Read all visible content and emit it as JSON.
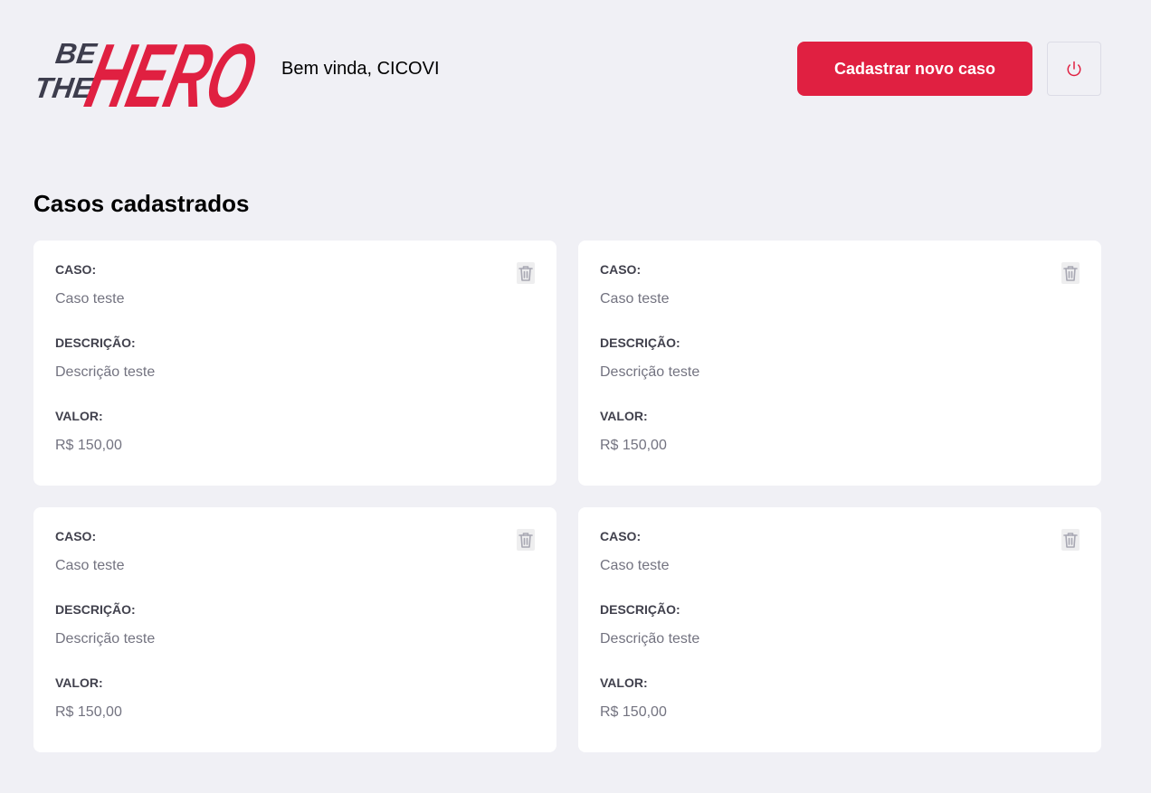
{
  "brand": {
    "logo_text_small_1": "BE",
    "logo_text_small_2": "THE",
    "logo_text_big": "HERO",
    "accent_color": "#e02041"
  },
  "header": {
    "welcome": "Bem vinda, CICOVI",
    "new_case_label": "Cadastrar novo caso",
    "logout_icon": "power-icon"
  },
  "main": {
    "title": "Casos cadastrados",
    "cases": [
      {
        "case_label": "CASO:",
        "case_value": "Caso teste",
        "desc_label": "DESCRIÇÃO:",
        "desc_value": "Descrição teste",
        "value_label": "VALOR:",
        "value_value": "R$ 150,00",
        "delete_icon": "trash-icon"
      },
      {
        "case_label": "CASO:",
        "case_value": "Caso teste",
        "desc_label": "DESCRIÇÃO:",
        "desc_value": "Descrição teste",
        "value_label": "VALOR:",
        "value_value": "R$ 150,00",
        "delete_icon": "trash-icon"
      },
      {
        "case_label": "CASO:",
        "case_value": "Caso teste",
        "desc_label": "DESCRIÇÃO:",
        "desc_value": "Descrição teste",
        "value_label": "VALOR:",
        "value_value": "R$ 150,00",
        "delete_icon": "trash-icon"
      },
      {
        "case_label": "CASO:",
        "case_value": "Caso teste",
        "desc_label": "DESCRIÇÃO:",
        "desc_value": "Descrição teste",
        "value_label": "VALOR:",
        "value_value": "R$ 150,00",
        "delete_icon": "trash-icon"
      }
    ]
  }
}
